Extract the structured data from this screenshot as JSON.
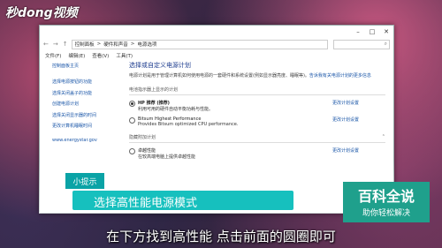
{
  "logo": "秒dong视频",
  "window": {
    "address": {
      "crumbs": [
        "控制面板",
        ">",
        "硬件和声音",
        ">",
        "电源选项"
      ],
      "search_icon": "search-icon"
    },
    "menu": [
      "文件(F)",
      "编辑(E)",
      "查看(V)",
      "工具(T)"
    ],
    "sidebar": {
      "head": "控制面板主页",
      "items": [
        "选择电源按钮的功能",
        "选择关闭盖子的功能",
        "创建电源计划",
        "选择关闭显示器的时间",
        "更改计算机睡眠时间"
      ],
      "see_also": "www.energystar.gov"
    },
    "main": {
      "title": "选择或自定义电源计划",
      "desc": "电源计划是用于管理计算机如何使用电源的一套硬件和系统设置(例如显示器亮度、睡眠等)。",
      "desc_link": "告诉我有关电源计划的更多信息",
      "section1": "电池指示器上显示的计划",
      "plans": [
        {
          "name": "HP 推荐 (推荐)",
          "desc": "利用可用的硬件自动平衡功耗与性能。",
          "link": "更改计划设置",
          "selected": true
        },
        {
          "name": "Bitsum Highest Performance",
          "desc": "Provides Bitsum optimized CPU performance.",
          "link": "更改计划设置",
          "selected": false
        }
      ],
      "section2": "隐藏附加计划",
      "plan3": {
        "name": "卓越性能",
        "desc": "在较高端电脑上提供卓越性能",
        "link": "更改计划设置"
      }
    }
  },
  "overlay": {
    "tag": "小提示",
    "caption": "选择高性能电源模式",
    "subtitle": "在下方找到高性能 点击前面的圆圈即可",
    "baike_title": "百科全说",
    "baike_sub": "助你轻松解决"
  }
}
